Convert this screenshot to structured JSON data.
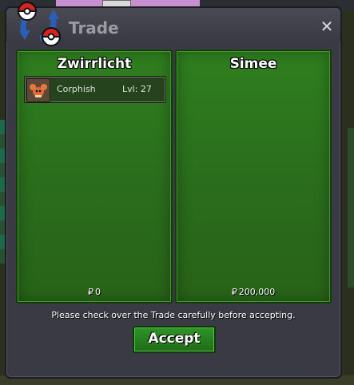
{
  "window": {
    "title": "Trade",
    "close_label": "✕"
  },
  "left_panel": {
    "player_name": "Zwirrlicht",
    "items": [
      {
        "name": "Corphish",
        "level": "Lvl: 27",
        "icon": "corphish-icon"
      }
    ],
    "money_symbol": "₽",
    "money": "0"
  },
  "right_panel": {
    "player_name": "Simee",
    "money_symbol": "₽",
    "money": "200,000"
  },
  "footer": {
    "notice": "Please check over the Trade carefully before accepting.",
    "accept_label": "Accept"
  },
  "colors": {
    "panel_green": "#2f7f1f",
    "window_bg": "#3a3a44",
    "accept_green": "#2f9326"
  }
}
